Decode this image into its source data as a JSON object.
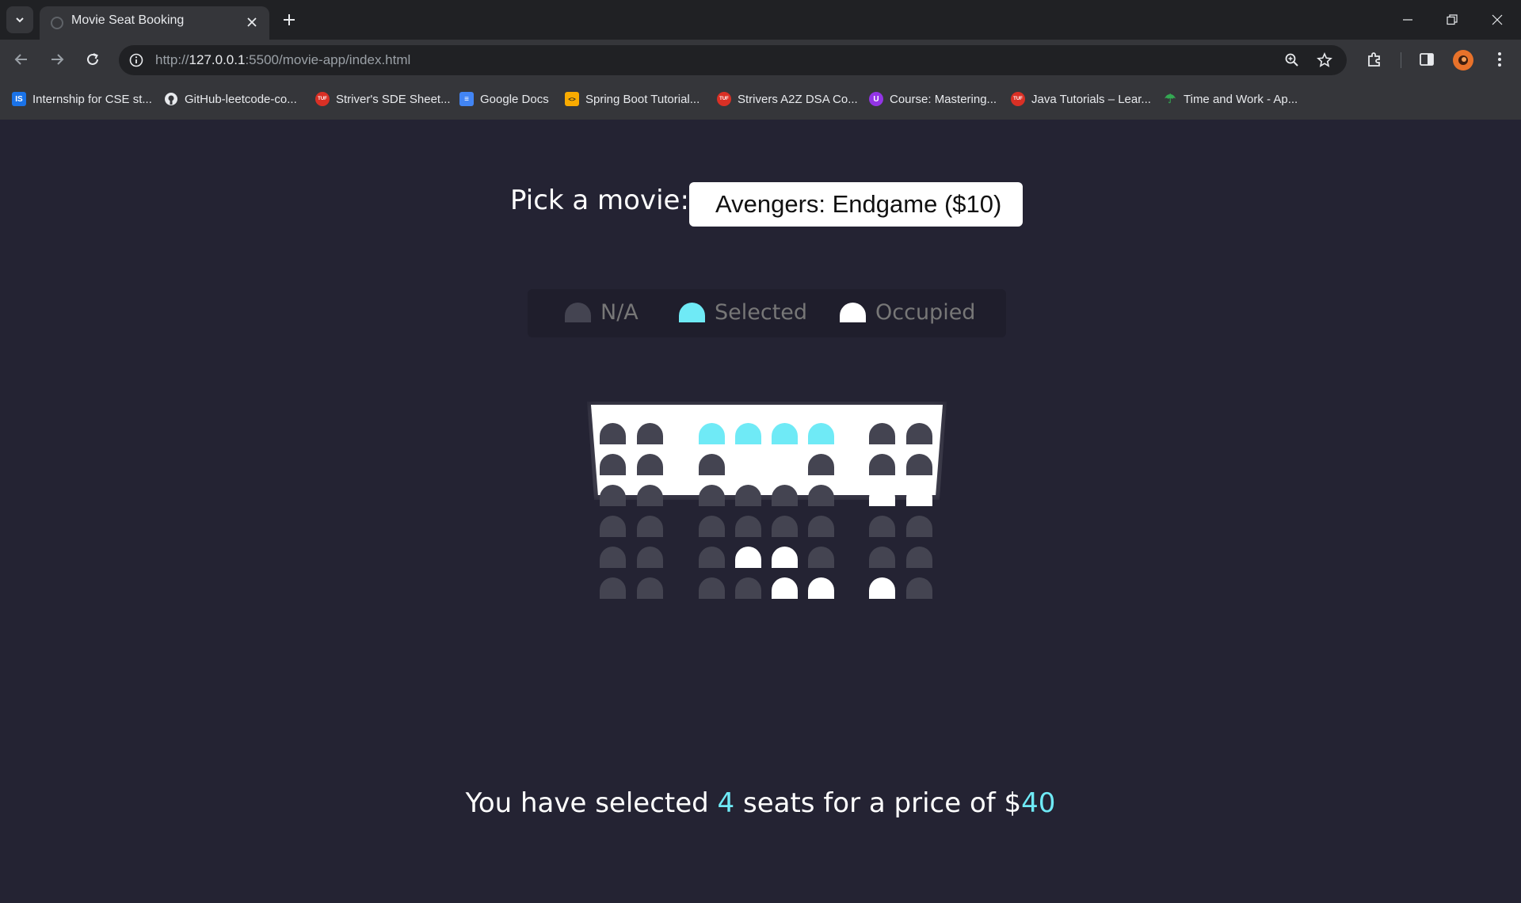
{
  "browser": {
    "tab_title": "Movie Seat Booking",
    "url_scheme": "http://",
    "url_host": "127.0.0.1",
    "url_rest": ":5500/movie-app/index.html",
    "bookmarks": [
      {
        "label": "Internship for CSE st...",
        "icon_text": "IS",
        "icon_color": "#1a73e8"
      },
      {
        "label": "GitHub-leetcode-co...",
        "icon_text": "",
        "icon_color": "#e8eaed"
      },
      {
        "label": "Striver's SDE Sheet...",
        "icon_text": "TUF",
        "icon_color": "#d93025"
      },
      {
        "label": "Google Docs",
        "icon_text": "≡",
        "icon_color": "#4285f4"
      },
      {
        "label": "Spring Boot Tutorial...",
        "icon_text": "<>",
        "icon_color": "#f9ab00"
      },
      {
        "label": "Strivers A2Z DSA Co...",
        "icon_text": "TUF",
        "icon_color": "#d93025"
      },
      {
        "label": "Course: Mastering...",
        "icon_text": "U",
        "icon_color": "#9334e6"
      },
      {
        "label": "Java Tutorials – Lear...",
        "icon_text": "TUF",
        "icon_color": "#d93025"
      },
      {
        "label": "Time and Work - Ap...",
        "icon_text": "☂",
        "icon_color": "#34a853"
      }
    ]
  },
  "app": {
    "picker_label": "Pick a movie:",
    "selected_movie": "Avengers: Endgame ($10)",
    "legend": [
      {
        "label": "N/A",
        "status": "available",
        "color": "#444451"
      },
      {
        "label": "Selected",
        "status": "selected",
        "color": "#6feaf6"
      },
      {
        "label": "Occupied",
        "status": "occupied",
        "color": "#ffffff"
      }
    ],
    "seat_rows": [
      [
        "available",
        "available",
        "selected",
        "selected",
        "selected",
        "selected",
        "available",
        "available"
      ],
      [
        "available",
        "available",
        "available",
        "occupied",
        "occupied",
        "available",
        "available",
        "available"
      ],
      [
        "available",
        "available",
        "available",
        "available",
        "available",
        "available",
        "occupied",
        "occupied"
      ],
      [
        "available",
        "available",
        "available",
        "available",
        "available",
        "available",
        "available",
        "available"
      ],
      [
        "available",
        "available",
        "available",
        "occupied",
        "occupied",
        "available",
        "available",
        "available"
      ],
      [
        "available",
        "available",
        "available",
        "available",
        "occupied",
        "occupied",
        "occupied",
        "available"
      ]
    ],
    "summary": {
      "prefix": "You have selected ",
      "count": "4",
      "middle": " seats for a price of $",
      "total": "40"
    }
  }
}
